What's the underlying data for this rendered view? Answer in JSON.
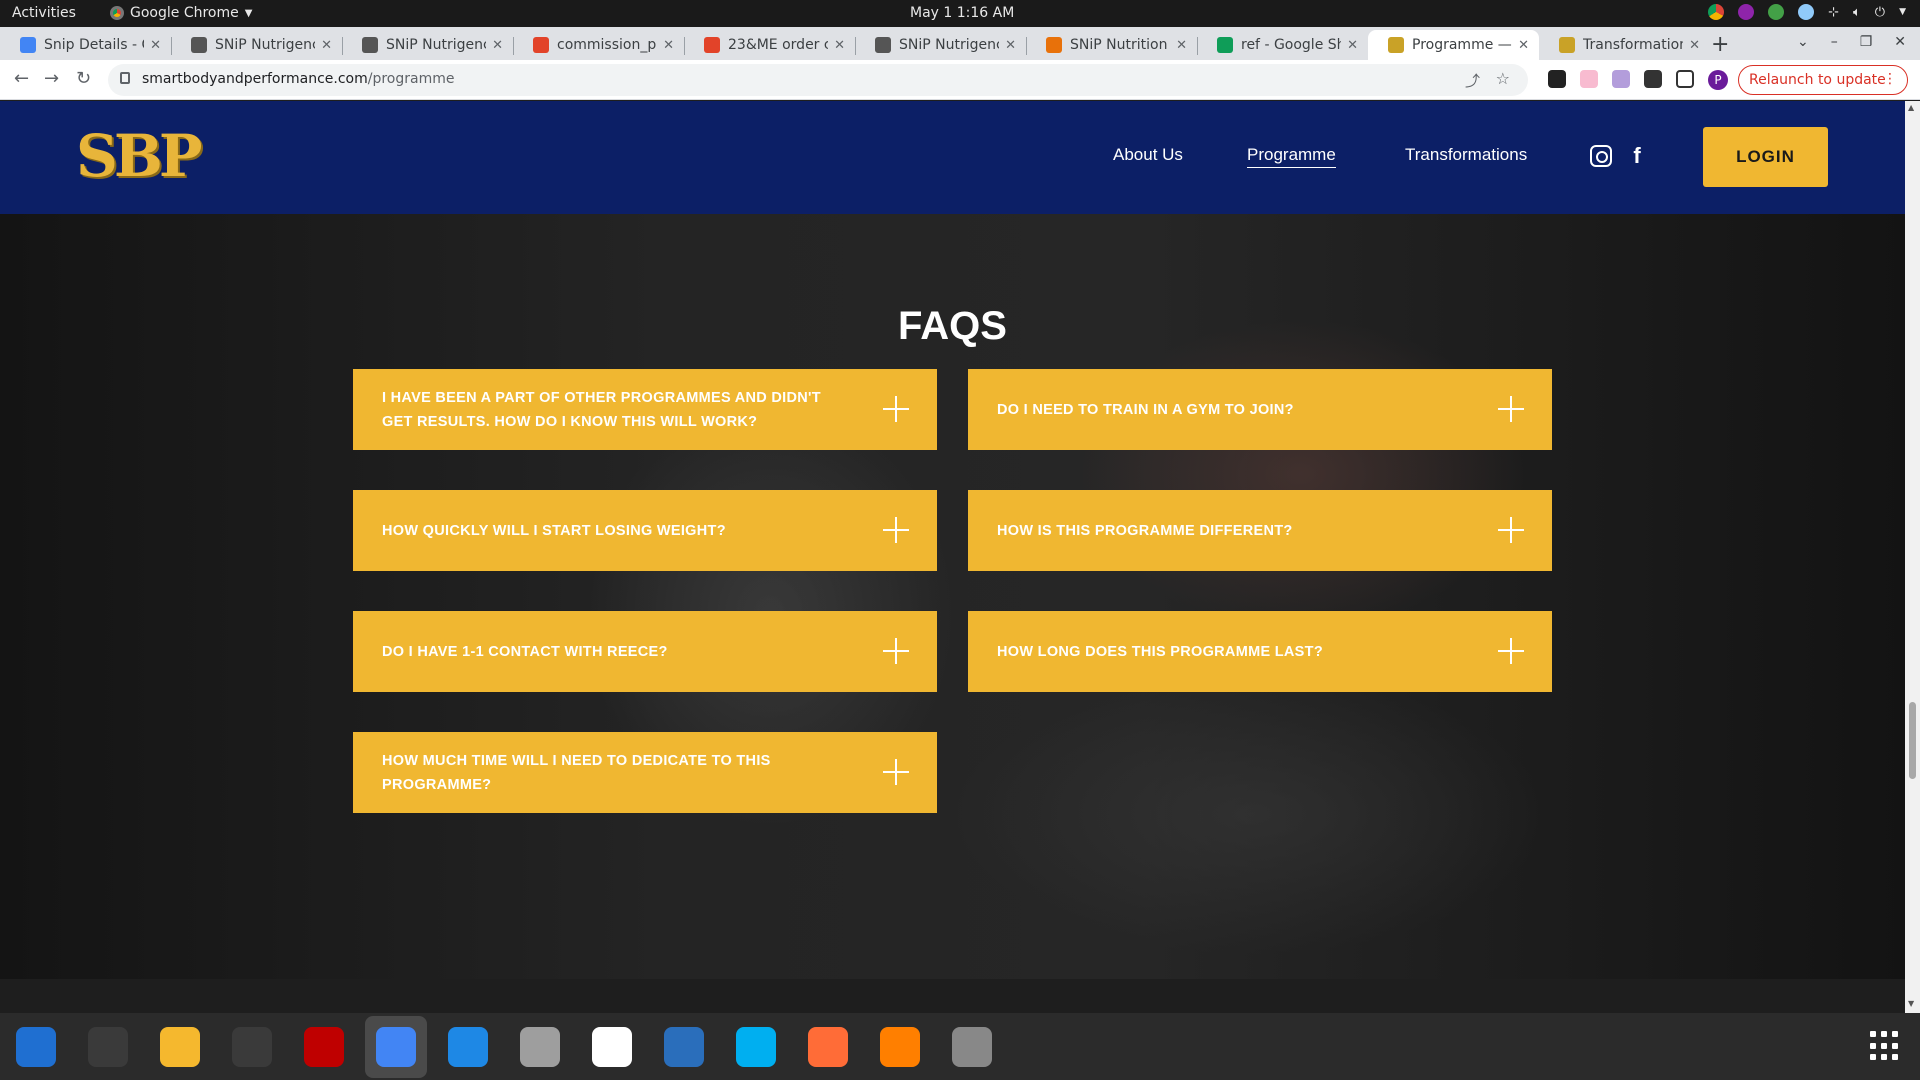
{
  "system": {
    "activities": "Activities",
    "app_name": "Google Chrome",
    "clock": "May 1  1:16 AM"
  },
  "tabs": [
    {
      "label": "Snip Details - G",
      "favicon": "docs-icon",
      "color": "#4285f4"
    },
    {
      "label": "SNiP Nutrigenc",
      "favicon": "snip-icon",
      "color": "#555555"
    },
    {
      "label": "SNiP Nutrigenc",
      "favicon": "snip-icon",
      "color": "#555555"
    },
    {
      "label": "commission_pa",
      "favicon": "gitlab-icon",
      "color": "#e24329"
    },
    {
      "label": "23&ME order cl",
      "favicon": "gitlab-icon",
      "color": "#e24329"
    },
    {
      "label": "SNiP Nutrigenc",
      "favicon": "snip-icon",
      "color": "#555555"
    },
    {
      "label": "SNiP Nutrition",
      "favicon": "snip-nutrition-icon",
      "color": "#e8710a"
    },
    {
      "label": "ref - Google She",
      "favicon": "sheets-icon",
      "color": "#0f9d58"
    },
    {
      "label": "Programme — ",
      "favicon": "sbp-icon",
      "color": "#c9a227",
      "active": true
    },
    {
      "label": "Transformation",
      "favicon": "sbp-icon",
      "color": "#c9a227"
    }
  ],
  "browser": {
    "url_host": "smartbodyandperformance.com",
    "url_path": "/programme",
    "relaunch": "Relaunch to update",
    "profile_initial": "P"
  },
  "site": {
    "logo": "SBP",
    "nav": [
      "About Us",
      "Programme",
      "Transformations"
    ],
    "login": "LOGIN",
    "faq_title": "FAQS",
    "faqs": [
      "I have been a part of other programmes and didn't get results. How do I know this will work?",
      "Do I need to train in a gym to join?",
      "How quickly will I start losing weight?",
      "How is this programme different?",
      "Do I have 1-1 contact with Reece?",
      "How long does this programme last?",
      "How much time will I need to dedicate to this programme?"
    ],
    "accent": "#f0b731",
    "header_bg": "#0c1f66"
  },
  "dock": [
    {
      "name": "thunderbird-icon",
      "color": "#1f6fd1"
    },
    {
      "name": "terminal-icon",
      "color": "#3a3a3a"
    },
    {
      "name": "calculator-icon",
      "color": "#f5b82e"
    },
    {
      "name": "system-monitor-icon",
      "color": "#3a3a3a"
    },
    {
      "name": "filezilla-icon",
      "color": "#bf0000"
    },
    {
      "name": "chrome-icon",
      "color": "#4285f4"
    },
    {
      "name": "vscode-icon",
      "color": "#1e88e5"
    },
    {
      "name": "files-icon",
      "color": "#9e9e9e"
    },
    {
      "name": "text-editor-icon",
      "color": "#ffffff"
    },
    {
      "name": "libreoffice-writer-icon",
      "color": "#2a6ebb"
    },
    {
      "name": "skype-icon",
      "color": "#00aff0"
    },
    {
      "name": "postman-icon",
      "color": "#ff6c37"
    },
    {
      "name": "hotspot-icon",
      "color": "#ff7f00"
    },
    {
      "name": "disks-icon",
      "color": "#888888"
    }
  ]
}
